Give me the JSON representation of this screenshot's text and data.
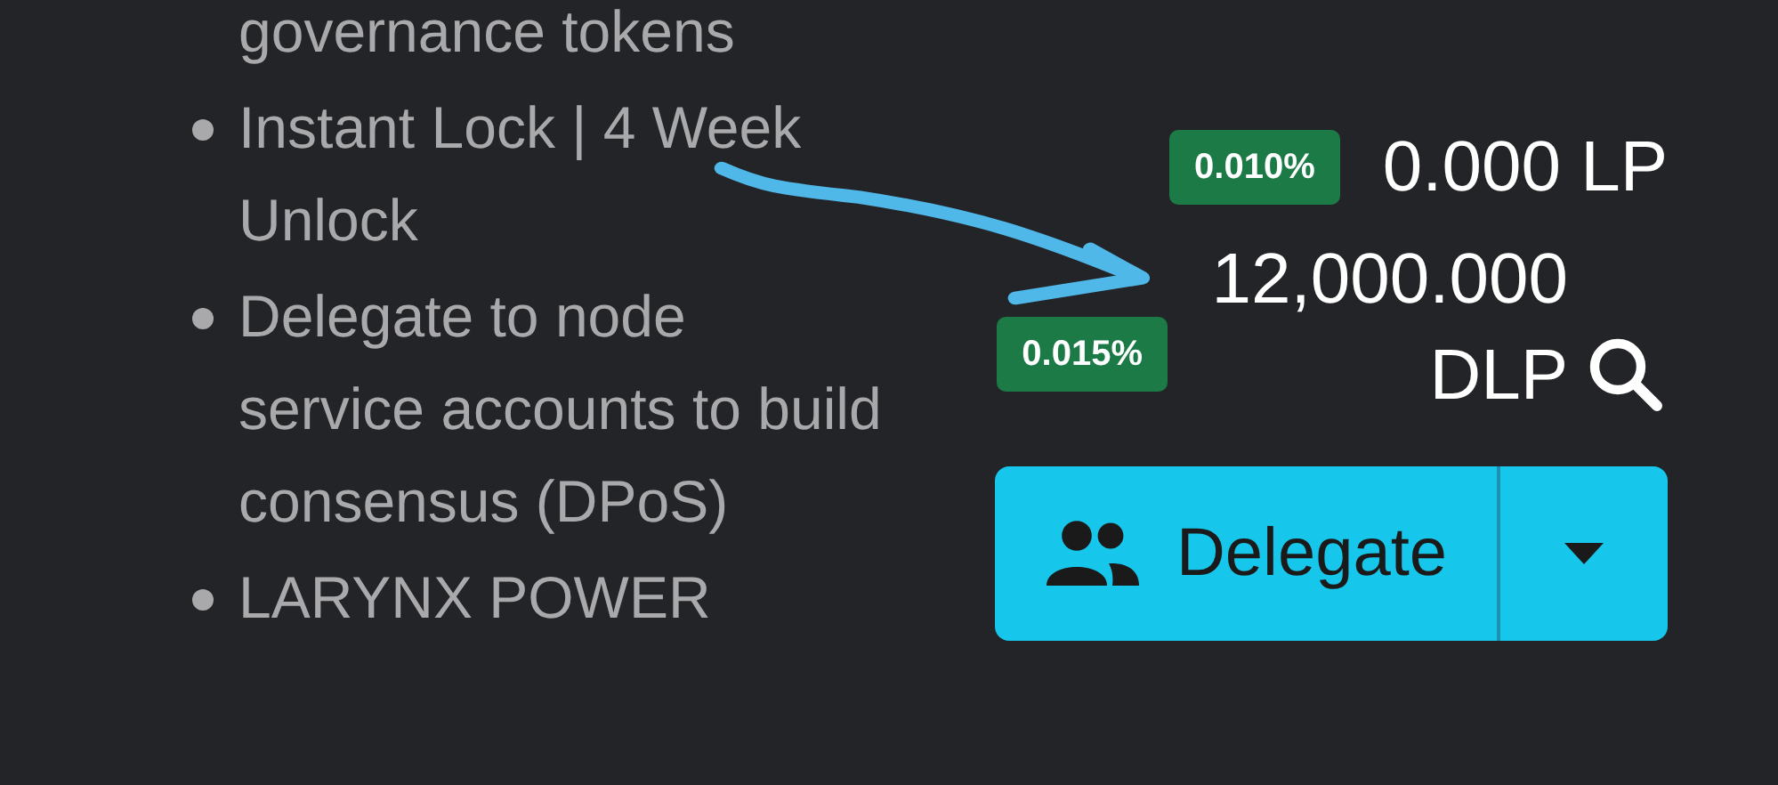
{
  "features": [
    {
      "kind": "continuation",
      "text": "governance tokens"
    },
    {
      "kind": "bullet",
      "text": "Instant Lock | 4 Week Unlock"
    },
    {
      "kind": "bullet",
      "text": "Delegate to node service accounts to build consensus (DPoS)"
    },
    {
      "kind": "bullet",
      "text": "LARYNX POWER"
    }
  ],
  "balances": [
    {
      "rate": "0.010%",
      "amount": "0.000 LP"
    },
    {
      "rate": "0.015%",
      "amount": "12,000.000 DLP"
    }
  ],
  "delegate_button": {
    "label": "Delegate"
  }
}
